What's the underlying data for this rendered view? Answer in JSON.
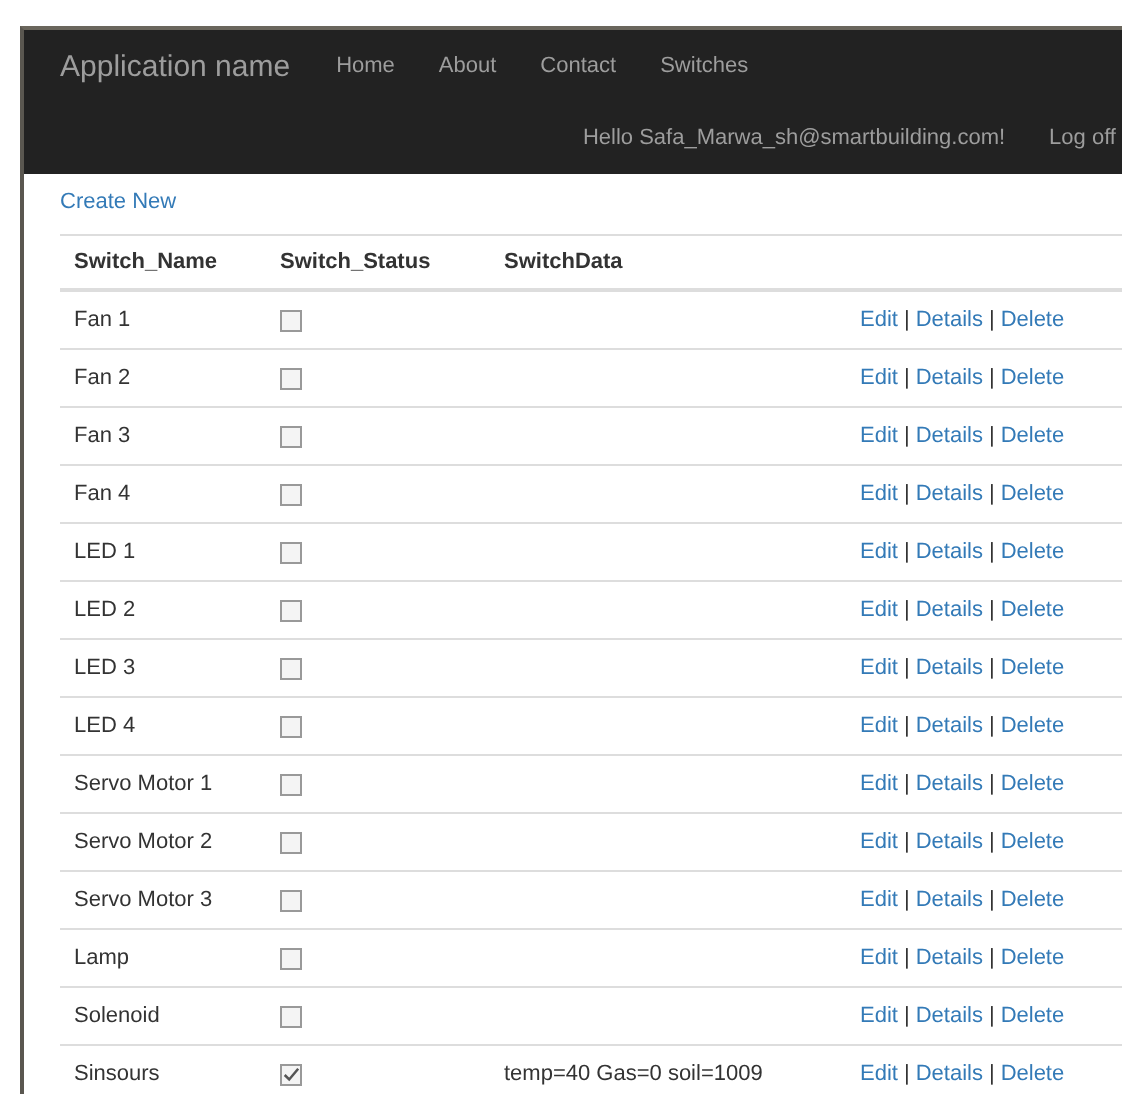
{
  "navbar": {
    "brand": "Application name",
    "links": [
      "Home",
      "About",
      "Contact",
      "Switches"
    ],
    "greeting": "Hello Safa_Marwa_sh@smartbuilding.com!",
    "logoff": "Log off"
  },
  "create_new": "Create New",
  "table": {
    "columns": [
      "Switch_Name",
      "Switch_Status",
      "SwitchData"
    ],
    "rows": [
      {
        "name": "Fan 1",
        "checked": false,
        "data": "",
        "actions": [
          "Edit",
          "Details",
          "Delete"
        ],
        "separator": "|"
      },
      {
        "name": "Fan 2",
        "checked": false,
        "data": "",
        "actions": [
          "Edit",
          "Details",
          "Delete"
        ],
        "separator": "|"
      },
      {
        "name": "Fan 3",
        "checked": false,
        "data": "",
        "actions": [
          "Edit",
          "Details",
          "Delete"
        ],
        "separator": "|"
      },
      {
        "name": "Fan 4",
        "checked": false,
        "data": "",
        "actions": [
          "Edit",
          "Details",
          "Delete"
        ],
        "separator": "|"
      },
      {
        "name": "LED 1",
        "checked": false,
        "data": "",
        "actions": [
          "Edit",
          "Details",
          "Delete"
        ],
        "separator": "|"
      },
      {
        "name": "LED 2",
        "checked": false,
        "data": "",
        "actions": [
          "Edit",
          "Details",
          "Delete"
        ],
        "separator": "|"
      },
      {
        "name": "LED 3",
        "checked": false,
        "data": "",
        "actions": [
          "Edit",
          "Details",
          "Delete"
        ],
        "separator": "|"
      },
      {
        "name": "LED 4",
        "checked": false,
        "data": "",
        "actions": [
          "Edit",
          "Details",
          "Delete"
        ],
        "separator": "|"
      },
      {
        "name": "Servo Motor 1",
        "checked": false,
        "data": "",
        "actions": [
          "Edit",
          "Details",
          "Delete"
        ],
        "separator": "|"
      },
      {
        "name": "Servo Motor 2",
        "checked": false,
        "data": "",
        "actions": [
          "Edit",
          "Details",
          "Delete"
        ],
        "separator": "|"
      },
      {
        "name": "Servo Motor 3",
        "checked": false,
        "data": "",
        "actions": [
          "Edit",
          "Details",
          "Delete"
        ],
        "separator": "|"
      },
      {
        "name": "Lamp",
        "checked": false,
        "data": "",
        "actions": [
          "Edit",
          "Details",
          "Delete"
        ],
        "separator": "|"
      },
      {
        "name": "Solenoid",
        "checked": false,
        "data": "",
        "actions": [
          "Edit",
          "Details",
          "Delete"
        ],
        "separator": "|"
      },
      {
        "name": "Sinsours",
        "checked": true,
        "data": "temp=40 Gas=0 soil=1009",
        "actions": [
          "Edit",
          "Details",
          "Delete"
        ],
        "separator": "|"
      }
    ]
  }
}
